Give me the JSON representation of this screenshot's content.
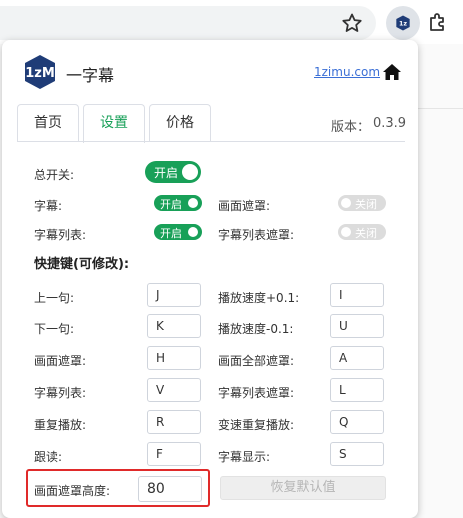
{
  "brand": {
    "name": "一字幕",
    "site_link": "1zimu.com"
  },
  "tabs": [
    {
      "label": "首页"
    },
    {
      "label": "设置"
    },
    {
      "label": "价格"
    }
  ],
  "version": {
    "label": "版本：",
    "value": "0.3.9"
  },
  "toggles": {
    "master": {
      "label": "总开关:",
      "state": "开启"
    },
    "subtitle": {
      "label": "字幕:",
      "state": "开启"
    },
    "subtitle_list": {
      "label": "字幕列表:",
      "state": "开启"
    },
    "screen_mask": {
      "label": "画面遮罩:",
      "state": "关闭"
    },
    "subtitle_list_mask": {
      "label": "字幕列表遮罩:",
      "state": "关闭"
    }
  },
  "shortcuts_title": "快捷键(可修改):",
  "shortcuts_left": [
    {
      "label": "上一句:",
      "key": "J"
    },
    {
      "label": "下一句:",
      "key": "K"
    },
    {
      "label": "画面遮罩:",
      "key": "H"
    },
    {
      "label": "字幕列表:",
      "key": "V"
    },
    {
      "label": "重复播放:",
      "key": "R"
    },
    {
      "label": "跟读:",
      "key": "F"
    }
  ],
  "shortcuts_right": [
    {
      "label": "播放速度+0.1:",
      "key": "I"
    },
    {
      "label": "播放速度-0.1:",
      "key": "U"
    },
    {
      "label": "画面全部遮罩:",
      "key": "A"
    },
    {
      "label": "字幕列表遮罩:",
      "key": "L"
    },
    {
      "label": "变速重复播放:",
      "key": "Q"
    },
    {
      "label": "字幕显示:",
      "key": "S"
    }
  ],
  "mask_height": {
    "label": "画面遮罩高度:",
    "value": "80"
  },
  "reset_button": "恢复默认值",
  "colors": {
    "accent": "#18a058",
    "highlight": "#e02a2a",
    "link": "#3b6fd6"
  }
}
